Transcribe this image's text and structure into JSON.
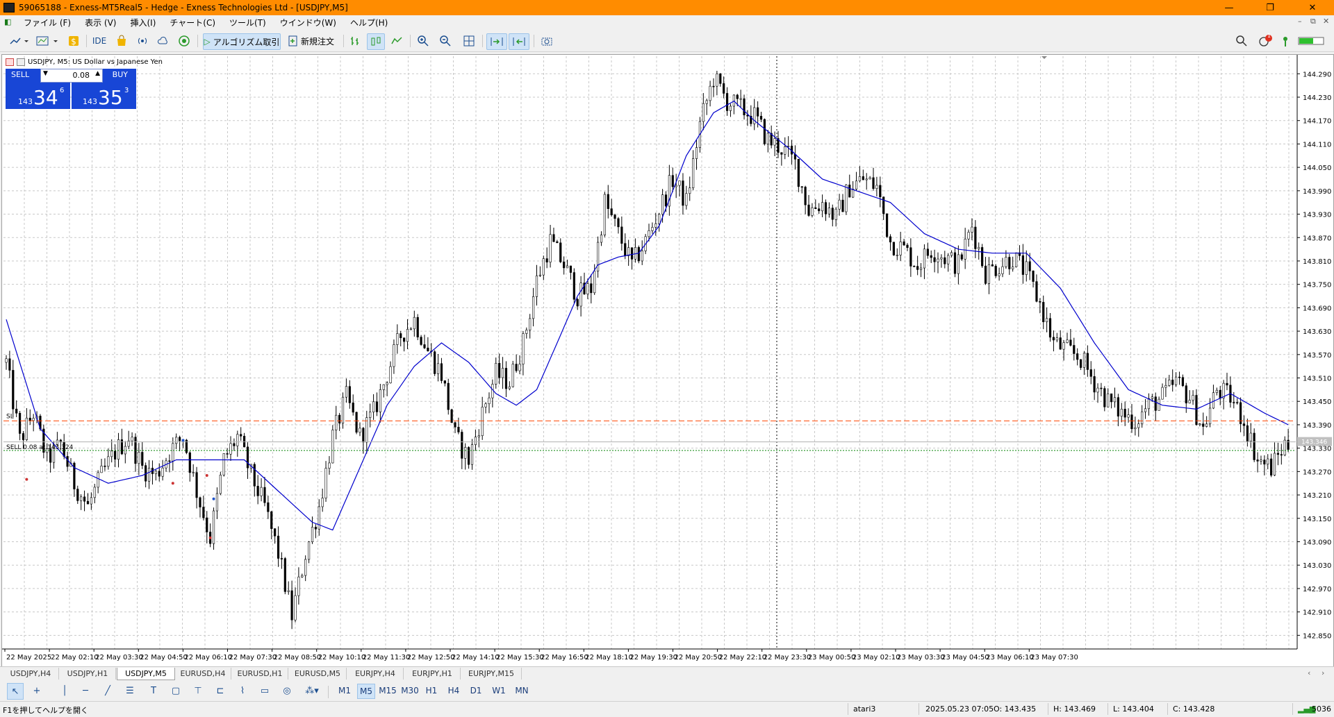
{
  "window": {
    "title": "59065188 - Exness-MT5Real5 - Hedge - Exness Technologies Ltd - [USDJPY,M5]",
    "controls": {
      "minimize": "—",
      "maximize": "❐",
      "close": "✕"
    }
  },
  "menu": {
    "items": [
      "ファイル (F)",
      "表示 (V)",
      "挿入(I)",
      "チャート(C)",
      "ツール(T)",
      "ウインドウ(W)",
      "ヘルプ(H)"
    ]
  },
  "toolbar": {
    "ide_label": "IDE",
    "algo_label": "アルゴリズム取引",
    "new_order_label": "新規注文",
    "notification_count": "1"
  },
  "chart": {
    "header": "USDJPY, M5:  US Dollar vs Japanese Yen",
    "trade_panel": {
      "sell_label": "SELL",
      "buy_label": "BUY",
      "volume": "0.08",
      "sell_prefix": "143",
      "sell_big": "34",
      "sell_sup": "6",
      "buy_prefix": "143",
      "buy_big": "35",
      "buy_sup": "3"
    },
    "sl_label": "SL",
    "position_label": "SELL 0.08 at 143.324",
    "current_price_label": "143.346",
    "colors": {
      "ma": "#0000cd",
      "sl_line": "#ff4500",
      "position_line": "#008000",
      "candles": "#000000"
    }
  },
  "chart_data": {
    "type": "candlestick",
    "symbol": "USDJPY",
    "timeframe": "M5",
    "ylim": [
      142.815,
      144.335
    ],
    "y_ticks": [
      144.29,
      144.23,
      144.17,
      144.11,
      144.05,
      143.99,
      143.93,
      143.87,
      143.81,
      143.75,
      143.69,
      143.63,
      143.57,
      143.51,
      143.45,
      143.39,
      143.33,
      143.27,
      143.21,
      143.15,
      143.09,
      143.03,
      142.97,
      142.91,
      142.85
    ],
    "x_labels": [
      "22 May 2025",
      "22 May 02:10",
      "22 May 03:30",
      "22 May 04:50",
      "22 May 06:10",
      "22 May 07:30",
      "22 May 08:50",
      "22 May 10:10",
      "22 May 11:30",
      "22 May 12:50",
      "22 May 14:10",
      "22 May 15:30",
      "22 May 16:50",
      "22 May 18:10",
      "22 May 19:30",
      "22 May 20:50",
      "22 May 22:10",
      "22 May 23:30",
      "23 May 00:50",
      "23 May 02:10",
      "23 May 03:30",
      "23 May 04:50",
      "23 May 06:10",
      "23 May 07:30"
    ],
    "stop_loss": 143.4,
    "position_price": 143.324,
    "current_price": 143.346,
    "price_path": [
      [
        0,
        143.55
      ],
      [
        4,
        143.35
      ],
      [
        8,
        143.42
      ],
      [
        12,
        143.3
      ],
      [
        16,
        143.34
      ],
      [
        20,
        143.24
      ],
      [
        24,
        143.18
      ],
      [
        28,
        143.26
      ],
      [
        32,
        143.32
      ],
      [
        36,
        143.36
      ],
      [
        40,
        143.28
      ],
      [
        44,
        143.26
      ],
      [
        48,
        143.32
      ],
      [
        52,
        143.36
      ],
      [
        56,
        143.22
      ],
      [
        60,
        143.1
      ],
      [
        64,
        143.3
      ],
      [
        68,
        143.36
      ],
      [
        72,
        143.26
      ],
      [
        76,
        143.18
      ],
      [
        80,
        143.06
      ],
      [
        84,
        142.9
      ],
      [
        88,
        143.06
      ],
      [
        92,
        143.18
      ],
      [
        96,
        143.36
      ],
      [
        100,
        143.46
      ],
      [
        104,
        143.36
      ],
      [
        108,
        143.42
      ],
      [
        112,
        143.52
      ],
      [
        116,
        143.62
      ],
      [
        120,
        143.66
      ],
      [
        124,
        143.58
      ],
      [
        128,
        143.52
      ],
      [
        132,
        143.36
      ],
      [
        136,
        143.3
      ],
      [
        140,
        143.42
      ],
      [
        144,
        143.52
      ],
      [
        148,
        143.5
      ],
      [
        152,
        143.6
      ],
      [
        156,
        143.76
      ],
      [
        160,
        143.86
      ],
      [
        164,
        143.8
      ],
      [
        168,
        143.72
      ],
      [
        172,
        143.74
      ],
      [
        176,
        143.96
      ],
      [
        180,
        143.88
      ],
      [
        184,
        143.8
      ],
      [
        188,
        143.86
      ],
      [
        192,
        143.94
      ],
      [
        196,
        144.02
      ],
      [
        200,
        143.96
      ],
      [
        204,
        144.16
      ],
      [
        208,
        144.28
      ],
      [
        212,
        144.22
      ],
      [
        216,
        144.2
      ],
      [
        220,
        144.18
      ],
      [
        224,
        144.12
      ],
      [
        228,
        144.1
      ],
      [
        232,
        144.06
      ],
      [
        236,
        143.94
      ],
      [
        240,
        143.96
      ],
      [
        244,
        143.92
      ],
      [
        248,
        144.0
      ],
      [
        252,
        144.02
      ],
      [
        256,
        144.0
      ],
      [
        260,
        143.86
      ],
      [
        264,
        143.84
      ],
      [
        268,
        143.8
      ],
      [
        272,
        143.84
      ],
      [
        276,
        143.82
      ],
      [
        280,
        143.8
      ],
      [
        284,
        143.9
      ],
      [
        288,
        143.78
      ],
      [
        292,
        143.8
      ],
      [
        296,
        143.82
      ],
      [
        300,
        143.78
      ],
      [
        304,
        143.7
      ],
      [
        308,
        143.6
      ],
      [
        312,
        143.58
      ],
      [
        316,
        143.56
      ],
      [
        320,
        143.5
      ],
      [
        324,
        143.45
      ],
      [
        328,
        143.42
      ],
      [
        332,
        143.4
      ],
      [
        336,
        143.44
      ],
      [
        340,
        143.46
      ],
      [
        344,
        143.5
      ],
      [
        348,
        143.46
      ],
      [
        352,
        143.38
      ],
      [
        356,
        143.48
      ],
      [
        360,
        143.46
      ],
      [
        364,
        143.4
      ],
      [
        368,
        143.3
      ],
      [
        372,
        143.28
      ],
      [
        376,
        143.34
      ]
    ],
    "ma_path": [
      [
        0,
        143.66
      ],
      [
        10,
        143.38
      ],
      [
        20,
        143.28
      ],
      [
        30,
        143.24
      ],
      [
        40,
        143.26
      ],
      [
        50,
        143.3
      ],
      [
        60,
        143.3
      ],
      [
        70,
        143.3
      ],
      [
        80,
        143.22
      ],
      [
        90,
        143.14
      ],
      [
        96,
        143.12
      ],
      [
        104,
        143.28
      ],
      [
        112,
        143.44
      ],
      [
        120,
        143.54
      ],
      [
        128,
        143.6
      ],
      [
        136,
        143.55
      ],
      [
        144,
        143.47
      ],
      [
        150,
        143.44
      ],
      [
        156,
        143.48
      ],
      [
        162,
        143.6
      ],
      [
        168,
        143.72
      ],
      [
        174,
        143.8
      ],
      [
        180,
        143.82
      ],
      [
        186,
        143.83
      ],
      [
        192,
        143.9
      ],
      [
        200,
        144.08
      ],
      [
        208,
        144.19
      ],
      [
        214,
        144.22
      ],
      [
        220,
        144.17
      ],
      [
        230,
        144.1
      ],
      [
        240,
        144.02
      ],
      [
        250,
        143.99
      ],
      [
        260,
        143.96
      ],
      [
        270,
        143.88
      ],
      [
        280,
        143.84
      ],
      [
        290,
        143.83
      ],
      [
        300,
        143.83
      ],
      [
        310,
        143.74
      ],
      [
        320,
        143.6
      ],
      [
        330,
        143.48
      ],
      [
        340,
        143.44
      ],
      [
        350,
        143.43
      ],
      [
        360,
        143.47
      ],
      [
        370,
        143.42
      ],
      [
        377,
        143.39
      ]
    ]
  },
  "symbol_tabs": [
    "USDJPY,H4",
    "USDJPY,H1",
    "USDJPY,M5",
    "EURUSD,H4",
    "EURUSD,H1",
    "EURUSD,M5",
    "EURJPY,H4",
    "EURJPY,H1",
    "EURJPY,M15"
  ],
  "timeframes": [
    "M1",
    "M5",
    "M15",
    "M30",
    "H1",
    "H4",
    "D1",
    "W1",
    "MN"
  ],
  "status": {
    "help": "F1を押してヘルプを開く",
    "profile": "atari3",
    "time": "2025.05.23 07:05",
    "open": "O: 143.435",
    "high": "H: 143.469",
    "low": "L: 143.404",
    "close": "C: 143.428",
    "connection": "5036"
  }
}
